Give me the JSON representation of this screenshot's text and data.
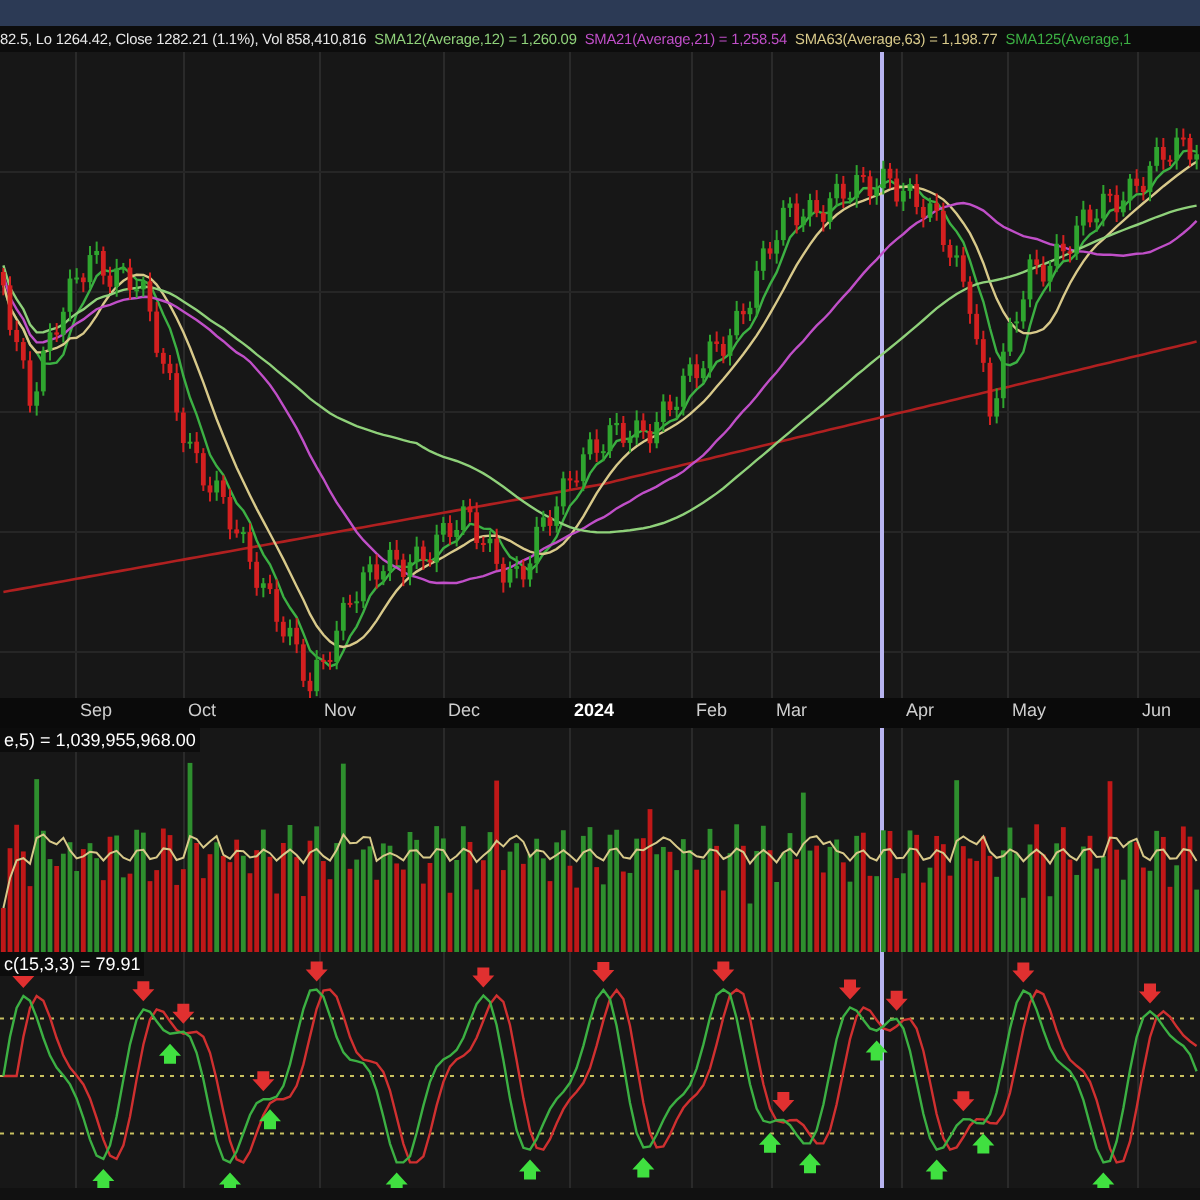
{
  "quote_bar": {
    "text": "82.5, Lo 1264.42, Close 1282.21 (1.1%), Vol 858,410,816",
    "indicators": [
      {
        "label": "SMA12(Average,12) = 1,260.09",
        "color": "#8fd17a"
      },
      {
        "label": "SMA21(Average,21) = 1,258.54",
        "color": "#c04fc8"
      },
      {
        "label": "SMA63(Average,63) = 1,198.77",
        "color": "#d8c98a"
      },
      {
        "label": "SMA125(Average,1",
        "color": "#3cb043"
      }
    ]
  },
  "x_axis": [
    {
      "label": "Sep",
      "kind": "month"
    },
    {
      "label": "Oct",
      "kind": "month"
    },
    {
      "label": "Nov",
      "kind": "month"
    },
    {
      "label": "Dec",
      "kind": "month"
    },
    {
      "label": "2024",
      "kind": "year"
    },
    {
      "label": "Feb",
      "kind": "month"
    },
    {
      "label": "Mar",
      "kind": "month"
    },
    {
      "label": "Apr",
      "kind": "month"
    },
    {
      "label": "May",
      "kind": "month"
    },
    {
      "label": "Jun",
      "kind": "month"
    }
  ],
  "volume_panel": {
    "label": "e,5) = 1,039,955,968.00"
  },
  "oscillator_panel": {
    "label": "c(15,3,3) = 79.91"
  }
}
